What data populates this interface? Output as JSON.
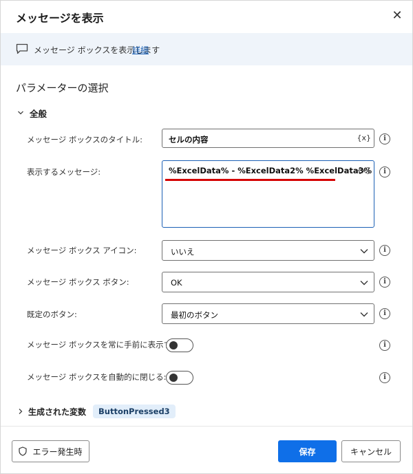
{
  "dialog": {
    "title": "メッセージを表示",
    "close_glyph": "✕"
  },
  "info": {
    "text": "メッセージ ボックスを表示します",
    "link": "詳細"
  },
  "section": {
    "title": "パラメーターの選択",
    "group_label": "全般"
  },
  "fields": {
    "title_label": "メッセージ ボックスのタイトル:",
    "title_value": "セルの内容",
    "message_label": "表示するメッセージ:",
    "message_value": "%ExcelData% - %ExcelData2% %ExcelData3%",
    "icon_label": "メッセージ ボックス アイコン:",
    "icon_value": "いいえ",
    "buttons_label": "メッセージ ボックス ボタン:",
    "buttons_value": "OK",
    "default_label": "既定のボタン:",
    "default_value": "最初のボタン",
    "topmost_label": "メッセージ ボックスを常に手前に表示する:",
    "autoclose_label": "メッセージ ボックスを自動的に閉じる:",
    "var_glyph": "{x}",
    "info_glyph": "i"
  },
  "output": {
    "label": "生成された変数",
    "variable": "ButtonPressed3"
  },
  "footer": {
    "error_label": "エラー発生時",
    "save_label": "保存",
    "cancel_label": "キャンセル"
  },
  "icons": {
    "info": "comment-icon",
    "close": "close-icon",
    "dropdown": "chevron-down-icon",
    "shield": "shield-icon"
  },
  "colors": {
    "accent": "#0f6fe8",
    "link": "#1a5fb4",
    "focus_border": "#1a5fb4",
    "annotation_red": "#d40000",
    "badge_bg": "#e2eefa"
  }
}
